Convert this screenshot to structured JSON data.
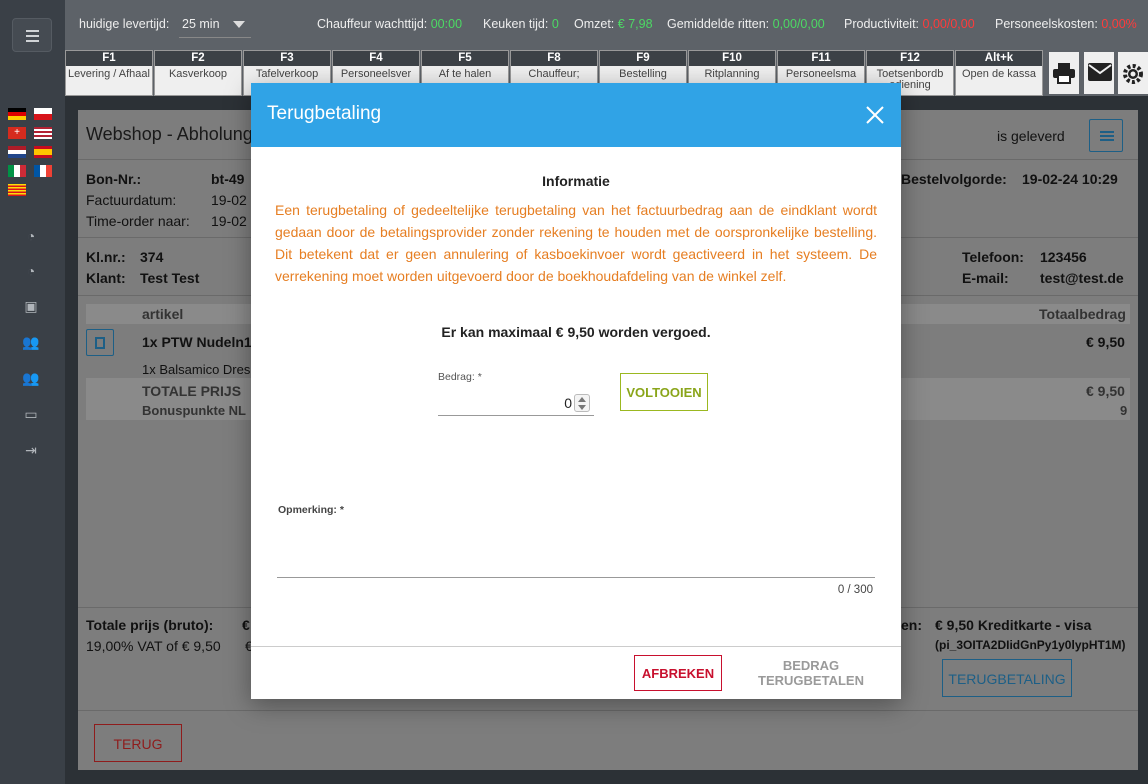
{
  "topbar": {
    "delivery_label": "huidige levertijd:",
    "delivery_value": "25 min",
    "driver_wait_label": "Chauffeur wachttijd:",
    "driver_wait_value": "00:00",
    "kitchen_label": "Keuken tijd:",
    "kitchen_value": "0",
    "revenue_label": "Omzet:",
    "revenue_value": "€ 7,98",
    "avg_rides_label": "Gemiddelde ritten:",
    "avg_rides_value": "0,00/0,00",
    "productivity_label": "Productiviteit:",
    "productivity_value": "0,00/0,00",
    "staff_cost_label": "Personeelskosten:",
    "staff_cost_value": "0,00%"
  },
  "fkeys": [
    {
      "key": "F1",
      "label": "Levering / Afhaal"
    },
    {
      "key": "F2",
      "label": "Kasverkoop"
    },
    {
      "key": "F3",
      "label": "Tafelverkoop"
    },
    {
      "key": "F4",
      "label": "Personeelsver"
    },
    {
      "key": "F5",
      "label": "Af te halen"
    },
    {
      "key": "F8",
      "label": "Chauffeur;"
    },
    {
      "key": "F9",
      "label": "Bestelling"
    },
    {
      "key": "F10",
      "label": "Ritplanning"
    },
    {
      "key": "F11",
      "label": "Personeelsma"
    },
    {
      "key": "F12",
      "label": "Toetsenbordb ediening"
    },
    {
      "key": "Alt+k",
      "label": "Open de kassa"
    }
  ],
  "page": {
    "title": "Webshop - Abholung",
    "status": "is geleverd",
    "bon_label": "Bon-Nr.:",
    "bon_value": "bt-49",
    "invoice_date_label": "Factuurdatum:",
    "invoice_date_value": "19-02",
    "time_order_label": "Time-order naar:",
    "time_order_value": "19-02",
    "order_seq_label": "Bestelvolgorde:",
    "order_seq_value": "19-02-24 10:29",
    "customer_nr_label": "Kl.nr.:",
    "customer_nr_value": "374",
    "customer_label": "Klant:",
    "customer_value": "Test Test",
    "phone_label": "Telefoon:",
    "phone_value": "123456",
    "email_label": "E-mail:",
    "email_value": "test@test.de",
    "col_article": "artikel",
    "col_total": "Totaalbedrag",
    "item_name": "1x PTW Nudeln1",
    "item_price": "€ 9,50",
    "item_sub": "1x Balsamico Dres",
    "total_price_label": "TOTALE PRIJS",
    "total_price_value": "€ 9,50",
    "bonus_label": "Bonuspunkte NL",
    "bonus_value": "9",
    "gross_label": "Totale prijs (bruto):",
    "gross_prefix": "€",
    "vat_label": "19,00% VAT of € 9,50",
    "vat_prefix": "€",
    "payment_label": "en:",
    "payment_value": "€ 9,50 Kreditkarte - visa",
    "payment_ref": "(pi_3OITA2DIidGnPy1y0lypHT1M)",
    "refund_button": "TERUGBETALING",
    "back_button": "TERUG"
  },
  "modal": {
    "title": "Terugbetaling",
    "info_title": "Informatie",
    "info_text": "Een terugbetaling of gedeeltelijke terugbetaling van het factuurbedrag aan de eindklant wordt gedaan door de betalingsprovider zonder rekening te houden met de oorspronkelijke bestelling. Dit betekent dat er geen annulering of kasboekinvoer wordt geactiveerd in het systeem. De verrekening moet worden uitgevoerd door de boekhoudafdeling van de winkel zelf.",
    "max_text": "Er kan maximaal € 9,50 worden vergoed.",
    "amount_label": "Bedrag: *",
    "amount_value": "0",
    "complete_button": "VOLTOOIEN",
    "remark_label": "Opmerking: *",
    "remark_value": "",
    "counter": "0 / 300",
    "cancel_button": "AFBREKEN",
    "refund_button": "BEDRAG TERUGBETALEN"
  }
}
